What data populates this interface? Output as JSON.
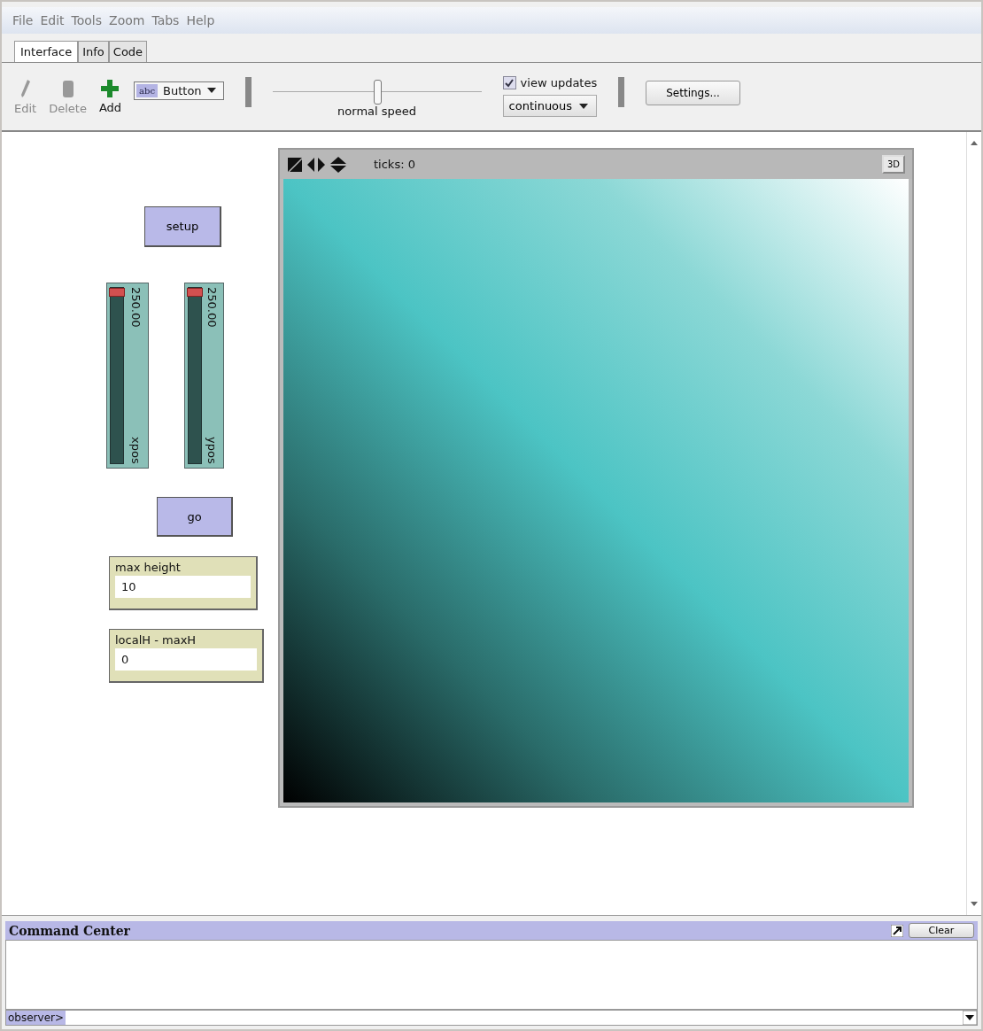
{
  "menu": [
    "File",
    "Edit",
    "Tools",
    "Zoom",
    "Tabs",
    "Help"
  ],
  "tabs": [
    {
      "label": "Interface",
      "selected": true
    },
    {
      "label": "Info",
      "selected": false
    },
    {
      "label": "Code",
      "selected": false
    }
  ],
  "toolbar": {
    "edit": "Edit",
    "delete": "Delete",
    "add": "Add",
    "widget_icon": "abc",
    "widget_type": "Button",
    "speed": {
      "label": "normal speed",
      "level": 0.5
    },
    "view_updates": {
      "label": "view updates",
      "checked": true
    },
    "update_mode": "continuous",
    "settings": "Settings..."
  },
  "widgets": [
    {
      "kind": "button",
      "label": "setup"
    },
    {
      "kind": "slider",
      "label": "xpos",
      "value": "250.00",
      "level": 1
    },
    {
      "kind": "slider",
      "label": "ypos",
      "value": "250.00",
      "level": 1
    },
    {
      "kind": "button",
      "label": "go"
    },
    {
      "kind": "input",
      "label": "max height",
      "value": "10"
    },
    {
      "kind": "input",
      "label": "localH - maxH",
      "value": "0"
    }
  ],
  "view": {
    "ticks": "ticks: 0",
    "three_d": "3D"
  },
  "command_center": {
    "title": "Command Center",
    "clear": "Clear",
    "prompt": "observer>"
  }
}
